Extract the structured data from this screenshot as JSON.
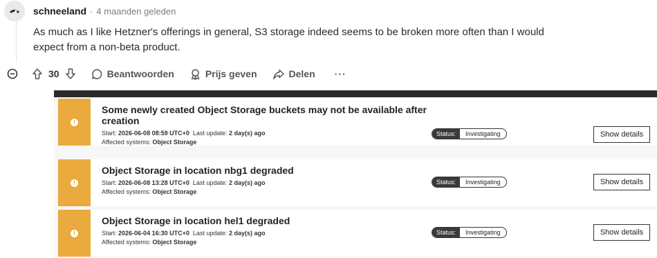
{
  "comment": {
    "username": "schneeland",
    "separator": "·",
    "time": "4 maanden geleden",
    "body": "As much as I like Hetzner's offerings in general, S3 storage indeed seems to be broken more often than I would expect from a non-beta product.",
    "actions": {
      "vote_count": "30",
      "reply": "Beantwoorden",
      "award": "Prijs geven",
      "share": "Delen",
      "more": "···"
    }
  },
  "incidents": [
    {
      "title": "Some newly created Object Storage buckets may not be available after creation",
      "start_label": "Start:",
      "start": "2026-06-08 08:59 UTC+0",
      "update_label": "Last update:",
      "update": "2 day(s) ago",
      "affected_label": "Affected systems:",
      "affected": "Object Storage",
      "status_label": "Status:",
      "status": "Investigating",
      "button": "Show details"
    },
    {
      "title": "Object Storage in location nbg1 degraded",
      "start_label": "Start:",
      "start": "2026-06-08 13:28 UTC+0",
      "update_label": "Last update:",
      "update": "2 day(s) ago",
      "affected_label": "Affected systems:",
      "affected": "Object Storage",
      "status_label": "Status:",
      "status": "Investigating",
      "button": "Show details"
    },
    {
      "title": "Object Storage in location hel1 degraded",
      "start_label": "Start:",
      "start": "2026-06-04 16:30 UTC+0",
      "update_label": "Last update:",
      "update": "2 day(s) ago",
      "affected_label": "Affected systems:",
      "affected": "Object Storage",
      "status_label": "Status:",
      "status": "Investigating",
      "button": "Show details"
    }
  ],
  "colors": {
    "incident_accent": "#eaaa3d",
    "embed_topbar": "#2b2b2d",
    "status_label_bg": "#3a3a3c"
  },
  "icons": {
    "collapse": "circle-minus-icon",
    "upvote": "arrow-up-icon",
    "downvote": "arrow-down-icon",
    "reply": "speech-bubble-icon",
    "award": "award-icon",
    "share": "share-arrow-icon",
    "warning": "warning-icon"
  }
}
